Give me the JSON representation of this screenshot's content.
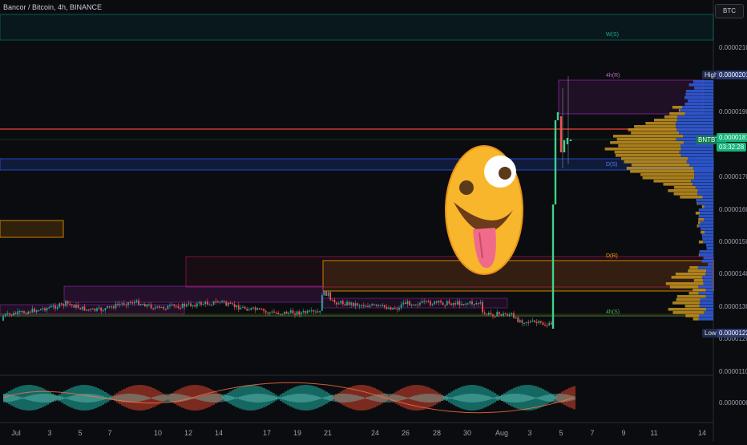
{
  "header": {
    "title": "Bancor / Bitcoin, 4h, BINANCE",
    "symbol_button": "BTC"
  },
  "price_axis": {
    "labels": [
      "0.00002100",
      "0.00001900",
      "0.00001700",
      "0.00001600",
      "0.00001500",
      "0.00001400",
      "0.00001300",
      "0.00001200",
      "0.00001100",
      "0.00000000"
    ],
    "high_label": "High",
    "high_value": "0.00002014",
    "last_symbol": "BNTBTC",
    "last_value": "0.00001816",
    "countdown": "03:32:28",
    "low_label": "Low",
    "low_value": "0.00001220"
  },
  "time_axis": {
    "labels": [
      "Jul",
      "3",
      "5",
      "7",
      "10",
      "12",
      "14",
      "17",
      "19",
      "21",
      "24",
      "26",
      "28",
      "30",
      "Aug",
      "3",
      "5",
      "7",
      "9",
      "11",
      "14"
    ]
  },
  "zone_labels": {
    "weekly": "W(S)",
    "four_h_r": "4h(R)",
    "daily_s": "D(S)",
    "daily_r": "D(R)",
    "four_h_s": "4h(S)"
  },
  "colors": {
    "up": "#26a69a",
    "down": "#ef5350",
    "spike": "#3fd18c",
    "red_line": "#f44336",
    "orange": "#ff9800",
    "blue_zone": "#2962ff",
    "teal_zone": "#00897b",
    "purple": "#9c27b0",
    "vp_gold": "#c7951f",
    "vp_blue": "#2f5bd9"
  },
  "icons": {
    "sticker": "zany-face-icon"
  }
}
